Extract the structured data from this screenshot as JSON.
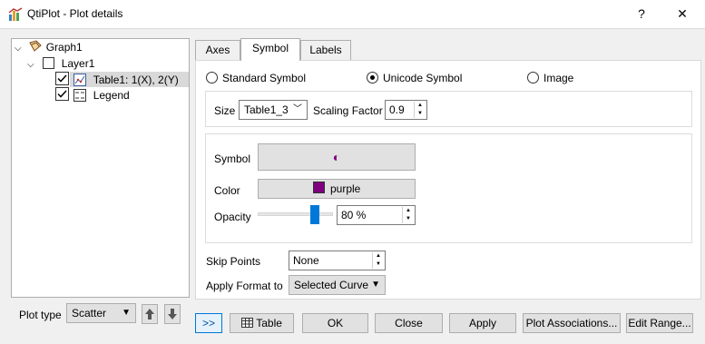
{
  "window": {
    "title": "QtiPlot - Plot details",
    "help_label": "?",
    "close_label": "✕"
  },
  "tree": {
    "graph": "Graph1",
    "layer": "Layer1",
    "curve": "Table1: 1(X), 2(Y)",
    "legend": "Legend"
  },
  "tabs": [
    "Axes",
    "Symbol",
    "Labels"
  ],
  "symbol_source": {
    "standard": "Standard Symbol",
    "unicode": "Unicode Symbol",
    "image": "Image",
    "selected": "Unicode Symbol"
  },
  "size": {
    "label": "Size",
    "value": "Table1_3"
  },
  "scaling": {
    "label": "Scaling Factor",
    "value": "0.9"
  },
  "symbol": {
    "label": "Symbol",
    "glyph": "◐"
  },
  "color": {
    "label": "Color",
    "value": "purple",
    "hex": "#800080"
  },
  "opacity": {
    "label": "Opacity",
    "value": "80 %",
    "level": 0.8
  },
  "skip": {
    "label": "Skip Points",
    "value": "None"
  },
  "apply": {
    "label": "Apply Format to",
    "value": "Selected Curve"
  },
  "plot_type": {
    "label": "Plot type",
    "value": "Scatter"
  },
  "buttons": {
    "expand": ">>",
    "table": "Table",
    "ok": "OK",
    "close": "Close",
    "apply": "Apply",
    "associations": "Plot Associations...",
    "edit_range": "Edit Range..."
  }
}
